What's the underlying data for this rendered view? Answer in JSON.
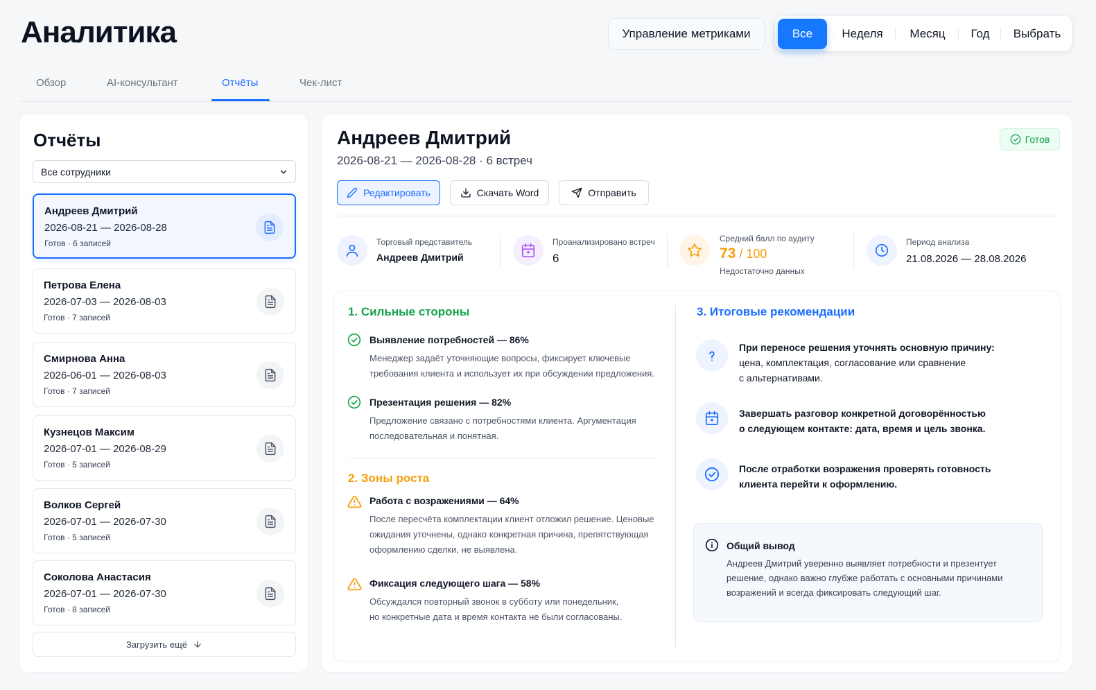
{
  "header": {
    "title": "Аналитика",
    "metrics_button": "Управление метриками",
    "periods": [
      "Все",
      "Неделя",
      "Месяц",
      "Год",
      "Выбрать"
    ],
    "active_period": "Все"
  },
  "tabs": [
    {
      "label": "Обзор"
    },
    {
      "label": "AI-консультант"
    },
    {
      "label": "Отчёты",
      "active": true
    },
    {
      "label": "Чек-лист"
    }
  ],
  "reports_panel": {
    "title": "Отчёты",
    "filter_value": "Все сотрудники",
    "items": [
      {
        "name": "Андреев Дмитрий",
        "dates": "2026-08-21 — 2026-08-28",
        "status": "Готов · 6 записей",
        "selected": true
      },
      {
        "name": "Петрова Елена",
        "dates": "2026-07-03 — 2026-08-03",
        "status": "Готов · 7 записей"
      },
      {
        "name": "Смирнова Анна",
        "dates": "2026-06-01 — 2026-08-03",
        "status": "Готов · 7 записей"
      },
      {
        "name": "Кузнецов Максим",
        "dates": "2026-07-01 — 2026-08-29",
        "status": "Готов · 5 записей"
      },
      {
        "name": "Волков Сергей",
        "dates": "2026-07-01 — 2026-07-30",
        "status": "Готов · 5 записей"
      },
      {
        "name": "Соколова Анастасия",
        "dates": "2026-07-01 — 2026-07-30",
        "status": "Готов · 8 записей"
      }
    ],
    "load_more": "Загрузить ещё"
  },
  "detail": {
    "name": "Андреев Дмитрий",
    "subtitle": "2026-08-21 — 2026-08-28 · 6 встреч",
    "status": "Готов",
    "actions": {
      "edit": "Редактировать",
      "download": "Скачать Word",
      "send": "Отправить"
    },
    "stats": {
      "rep_label": "Торговый представитель",
      "rep_value": "Андреев Дмитрий",
      "meetings_label": "Проанализировано встреч",
      "meetings_value": "6",
      "score_label": "Средний балл по аудиту",
      "score_value": "73",
      "score_max": "/ 100",
      "score_note": "Недостаточно данных",
      "period_label": "Период анализа",
      "period_value": "21.08.2026 — 28.08.2026"
    },
    "strengths": {
      "title": "1. Сильные стороны",
      "items": [
        {
          "title": "Выявление потребностей — 86%",
          "line1": "Менеджер задаёт уточняющие вопросы, фиксирует ключевые",
          "line2": "требования клиента и использует их при обсуждении предложения."
        },
        {
          "title": "Презентация решения — 82%",
          "line1": "Предложение связано с потребностями клиента. Аргументация",
          "line2": "последовательная и понятная."
        }
      ]
    },
    "growth": {
      "title": "2. Зоны роста",
      "items": [
        {
          "title": "Работа с возражениями — 64%",
          "line1": "После пересчёта комплектации клиент отложил решение. Ценовые",
          "line2": "ожидания уточнены, однако конкретная причина, препятствующая",
          "line3": "оформлению сделки, не выявлена."
        },
        {
          "title": "Фиксация следующего шага — 58%",
          "line1": "Обсуждался повторный звонок в субботу или понедельник,",
          "line2": "но конкретные дата и время контакта не были согласованы."
        }
      ]
    },
    "recommendations": {
      "title": "3. Итоговые рекомендации",
      "items": [
        {
          "line1": "При переносе решения уточнять основную причину:",
          "line2": "цена, комплектация, согласование или сравнение",
          "line3": "с альтернативами."
        },
        {
          "line1": "Завершать разговор конкретной договорённостью",
          "line2": "о следующем контакте: дата, время и цель звонка."
        },
        {
          "line1": "После отработки возражения проверять готовность",
          "line2": "клиента перейти к оформлению."
        }
      ]
    },
    "conclusion": {
      "title": "Общий вывод",
      "line1": "Андреев Дмитрий уверенно выявляет потребности и презентует",
      "line2": "решение, однако важно глубже работать с основными причинами",
      "line3": "возражений и всегда фиксировать следующий шаг."
    }
  },
  "colors": {
    "accent": "#1a6dff",
    "success": "#16a34a",
    "warning": "#f59e0b"
  }
}
